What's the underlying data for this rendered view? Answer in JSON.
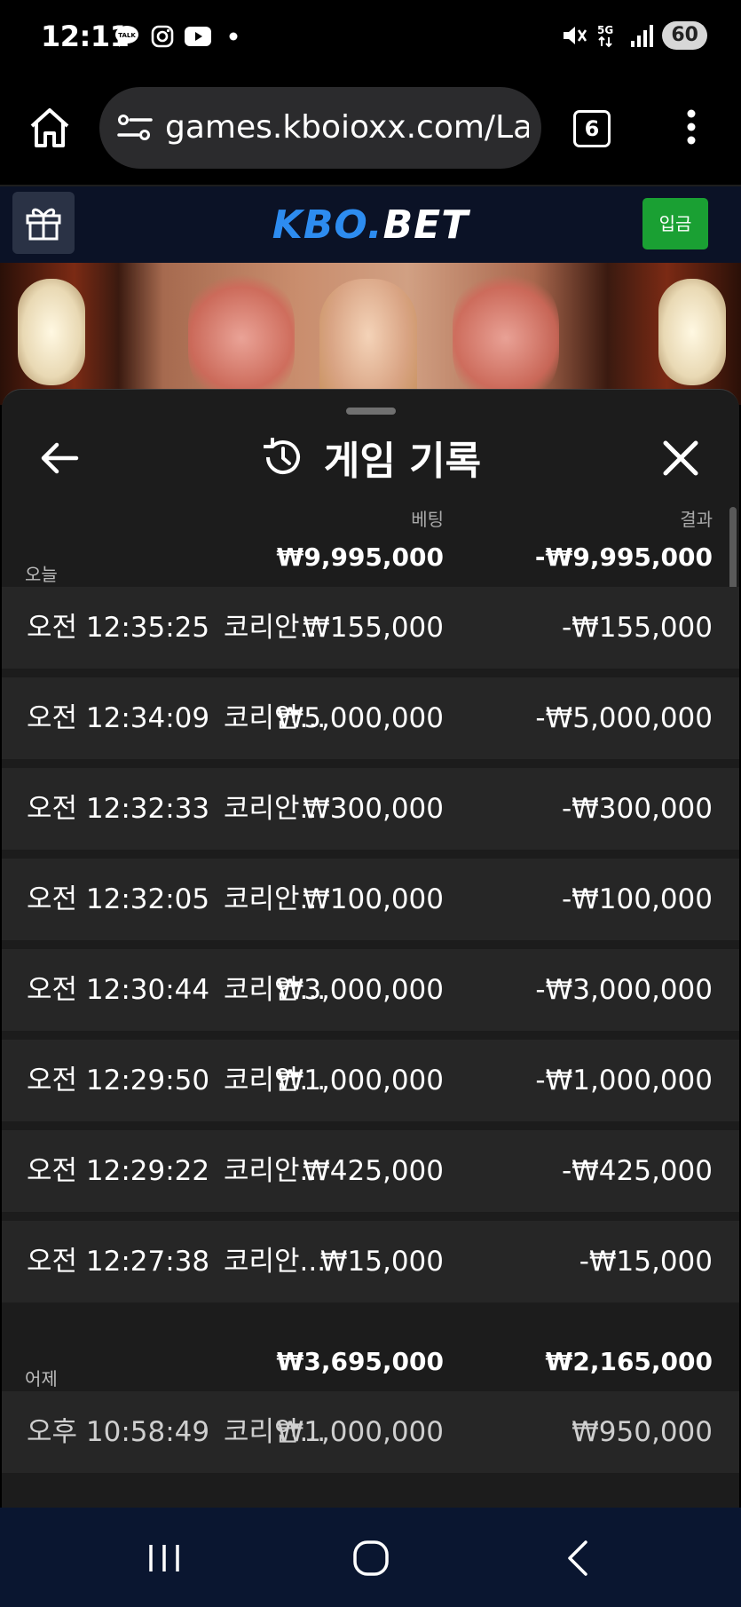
{
  "status": {
    "time": "12:11",
    "notif_icons": [
      "kakaotalk-icon",
      "instagram-icon",
      "youtube-icon",
      "dot-icon"
    ],
    "battery": "60"
  },
  "browser": {
    "url": "games.kboioxx.com/Laun",
    "tab_count": "6"
  },
  "site": {
    "logo_part1": "KBO.",
    "logo_part2": "BET",
    "deposit_label": "입금"
  },
  "panel": {
    "title": "게임 기록",
    "col_bet": "베팅",
    "col_result": "결과"
  },
  "groups": [
    {
      "label": "오늘",
      "bet_total": "₩9,995,000",
      "result_total": "-₩9,995,000",
      "rows": [
        {
          "time": "오전 12:35:25",
          "game": "코리안...",
          "bet": "₩155,000",
          "result": "-₩155,000"
        },
        {
          "time": "오전 12:34:09",
          "game": "코리안...",
          "bet": "₩5,000,000",
          "result": "-₩5,000,000"
        },
        {
          "time": "오전 12:32:33",
          "game": "코리안...",
          "bet": "₩300,000",
          "result": "-₩300,000"
        },
        {
          "time": "오전 12:32:05",
          "game": "코리안...",
          "bet": "₩100,000",
          "result": "-₩100,000"
        },
        {
          "time": "오전 12:30:44",
          "game": "코리안...",
          "bet": "₩3,000,000",
          "result": "-₩3,000,000"
        },
        {
          "time": "오전 12:29:50",
          "game": "코리안...",
          "bet": "₩1,000,000",
          "result": "-₩1,000,000"
        },
        {
          "time": "오전 12:29:22",
          "game": "코리안...",
          "bet": "₩425,000",
          "result": "-₩425,000"
        },
        {
          "time": "오전 12:27:38",
          "game": "코리안...",
          "bet": "₩15,000",
          "result": "-₩15,000"
        }
      ]
    },
    {
      "label": "어제",
      "bet_total": "₩3,695,000",
      "result_total": "₩2,165,000",
      "rows": [
        {
          "time": "오후 10:58:49",
          "game": "코리안...",
          "bet": "₩1,000,000",
          "result": "₩950,000"
        }
      ]
    }
  ],
  "colors": {
    "panel_bg": "#1c1c1c",
    "row_bg": "#262626",
    "deposit_green": "#1aa033",
    "logo_blue": "#2d8cf0",
    "nav_bg": "#0a1630"
  }
}
